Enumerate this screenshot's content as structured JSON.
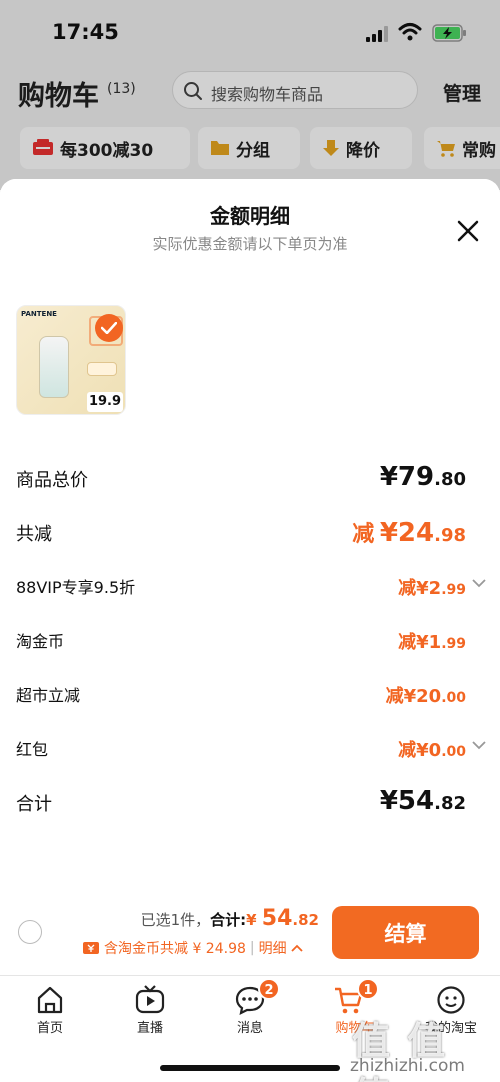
{
  "status_bar": {
    "time": "17:45"
  },
  "header": {
    "title": "购物车",
    "count": "(13)",
    "search_placeholder": "搜索购物车商品",
    "manage": "管理",
    "chips": [
      "每300减30",
      "分组",
      "降价",
      "常购"
    ]
  },
  "sheet": {
    "title": "金额明细",
    "subtitle": "实际优惠金额请以下单页为准",
    "product": {
      "brand": "PANTENE",
      "price": "19.9"
    },
    "rows": [
      {
        "label": "商品总价",
        "prefix": "",
        "yen": "¥",
        "int": "79",
        "dec": ".80",
        "style": "black"
      },
      {
        "label": "共减",
        "prefix": "减",
        "yen": "¥",
        "int": "24",
        "dec": ".98",
        "style": "orange"
      },
      {
        "label": "88VIP专享9.5折",
        "prefix": "减",
        "yen": "¥",
        "int": "2",
        "dec": ".99",
        "style": "orange"
      },
      {
        "label": "淘金币",
        "prefix": "减",
        "yen": "¥",
        "int": "1",
        "dec": ".99",
        "style": "orange"
      },
      {
        "label": "超市立减",
        "prefix": "减",
        "yen": "¥",
        "int": "20",
        "dec": ".00",
        "style": "orange"
      },
      {
        "label": "红包",
        "prefix": "减",
        "yen": "¥",
        "int": "0",
        "dec": ".00",
        "style": "orange"
      },
      {
        "label": "合计",
        "prefix": "",
        "yen": "¥",
        "int": "54",
        "dec": ".82",
        "style": "black"
      }
    ]
  },
  "bottom": {
    "selected": "已选1件，",
    "total_label": "合计:",
    "yen": "¥",
    "total_int": "54",
    "total_dec": ".82",
    "coin_text": "含淘金币共减 ¥ 24.98",
    "detail": "明细",
    "checkout": "结算"
  },
  "tabs": [
    {
      "label": "首页",
      "badge": ""
    },
    {
      "label": "直播",
      "badge": ""
    },
    {
      "label": "消息",
      "badge": "2"
    },
    {
      "label": "购物车",
      "badge": "1"
    },
    {
      "label": "我的淘宝",
      "badge": ""
    }
  ],
  "watermark": {
    "mark": "值 值 值",
    "site": "zhizhizhi.com"
  },
  "colors": {
    "accent": "#f26522",
    "button": "#f26a22"
  }
}
